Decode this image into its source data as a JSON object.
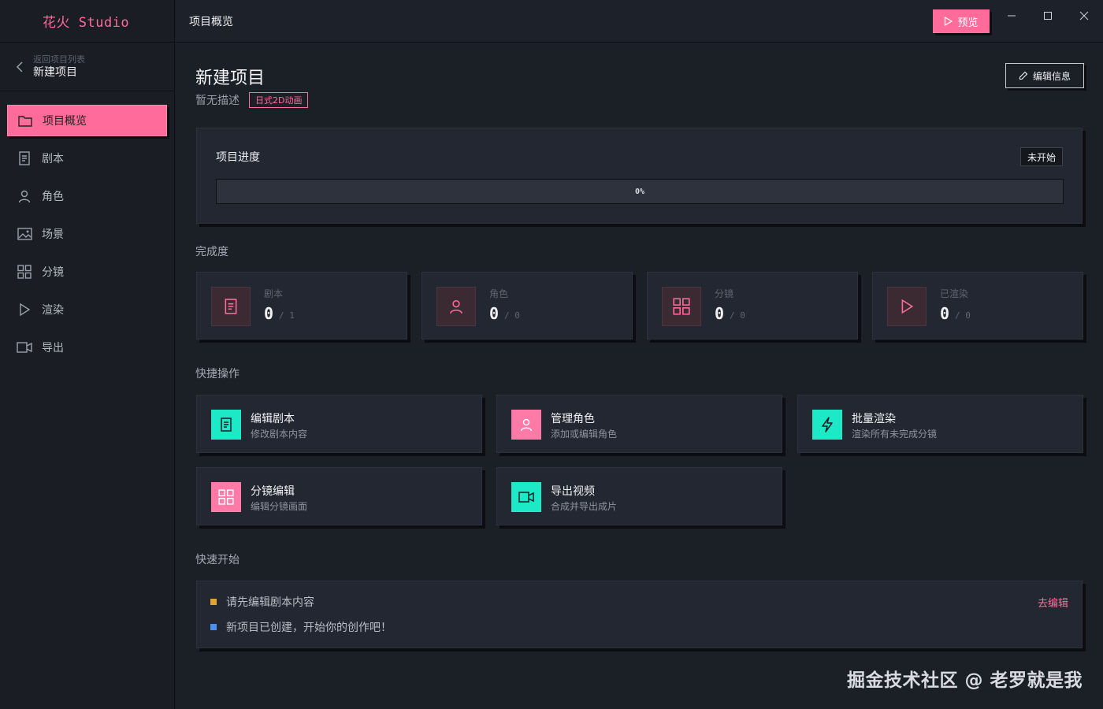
{
  "app": {
    "brand": "花火 Studio"
  },
  "sidebar": {
    "back_small": "返回项目列表",
    "back_big": "新建项目",
    "items": [
      {
        "label": "项目概览",
        "icon": "folder-icon"
      },
      {
        "label": "剧本",
        "icon": "document-icon"
      },
      {
        "label": "角色",
        "icon": "user-icon"
      },
      {
        "label": "场景",
        "icon": "image-icon"
      },
      {
        "label": "分镜",
        "icon": "grid-icon"
      },
      {
        "label": "渲染",
        "icon": "play-icon"
      },
      {
        "label": "导出",
        "icon": "video-icon"
      }
    ]
  },
  "topbar": {
    "title": "项目概览",
    "preview_label": "预览"
  },
  "project": {
    "title": "新建项目",
    "description": "暂无描述",
    "tag": "日式2D动画",
    "edit_label": "编辑信息"
  },
  "progress": {
    "label": "项目进度",
    "status": "未开始",
    "percent_text": "0%",
    "value": 0
  },
  "completion": {
    "label": "完成度",
    "stats": [
      {
        "label": "剧本",
        "value": "0",
        "total": "/ 1",
        "icon": "document-icon"
      },
      {
        "label": "角色",
        "value": "0",
        "total": "/ 0",
        "icon": "user-icon"
      },
      {
        "label": "分镜",
        "value": "0",
        "total": "/ 0",
        "icon": "grid-icon"
      },
      {
        "label": "已渲染",
        "value": "0",
        "total": "/ 0",
        "icon": "play-icon"
      }
    ]
  },
  "actions": {
    "label": "快捷操作",
    "items": [
      {
        "title": "编辑剧本",
        "subtitle": "修改剧本内容",
        "color": "#1de9c7",
        "icon": "document-icon"
      },
      {
        "title": "管理角色",
        "subtitle": "添加或编辑角色",
        "color": "#ff7aa6",
        "icon": "user-icon"
      },
      {
        "title": "批量渲染",
        "subtitle": "渲染所有未完成分镜",
        "color": "#1de9c7",
        "icon": "lightning-icon"
      },
      {
        "title": "分镜编辑",
        "subtitle": "编辑分镜画面",
        "color": "#ff7aa6",
        "icon": "grid-icon"
      },
      {
        "title": "导出视频",
        "subtitle": "合成并导出成片",
        "color": "#1de9c7",
        "icon": "video-icon"
      }
    ]
  },
  "quickstart": {
    "label": "快速开始",
    "items": [
      {
        "text": "请先编辑剧本内容",
        "color": "#e0a531"
      },
      {
        "text": "新项目已创建，开始你的创作吧！",
        "color": "#4d8ff0"
      }
    ],
    "go_edit": "去编辑"
  },
  "watermark": "掘金技术社区 @ 老罗就是我",
  "colors": {
    "accent": "#ff6b9a",
    "teal": "#1de9c7",
    "bg": "#1b1f26"
  }
}
